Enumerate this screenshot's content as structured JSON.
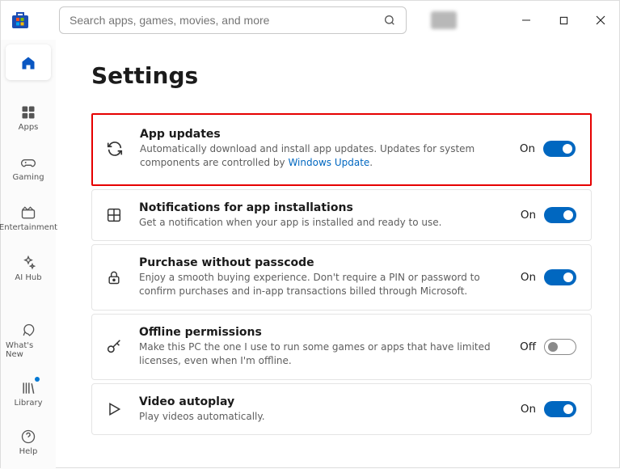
{
  "search": {
    "placeholder": "Search apps, games, movies, and more"
  },
  "sidebar": {
    "home": "",
    "items": [
      {
        "label": "Apps"
      },
      {
        "label": "Gaming"
      },
      {
        "label": "Entertainment"
      },
      {
        "label": "AI Hub"
      }
    ],
    "bottom": [
      {
        "label": "What's New"
      },
      {
        "label": "Library"
      },
      {
        "label": "Help"
      }
    ]
  },
  "page": {
    "title": "Settings"
  },
  "settings": [
    {
      "title": "App updates",
      "desc_pre": "Automatically download and install app updates. Updates for system components are controlled by ",
      "link": "Windows Update",
      "desc_post": ".",
      "state": "On"
    },
    {
      "title": "Notifications for app installations",
      "desc": "Get a notification when your app is installed and ready to use.",
      "state": "On"
    },
    {
      "title": "Purchase without passcode",
      "desc": "Enjoy a smooth buying experience. Don't require a PIN or password to confirm purchases and in-app transactions billed through Microsoft.",
      "state": "On"
    },
    {
      "title": "Offline permissions",
      "desc": "Make this PC the one I use to run some games or apps that have limited licenses, even when I'm offline.",
      "state": "Off"
    },
    {
      "title": "Video autoplay",
      "desc": "Play videos automatically.",
      "state": "On"
    }
  ]
}
